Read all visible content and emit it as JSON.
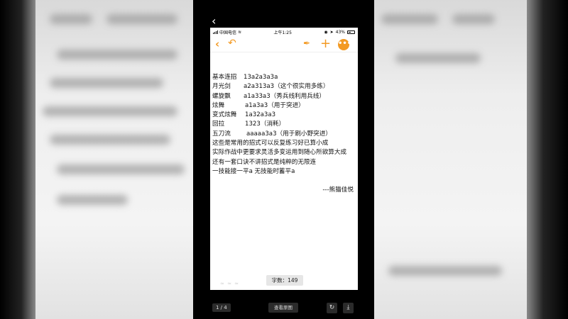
{
  "status_bar": {
    "carrier": "中国电信",
    "time": "上午1:25",
    "battery": "43%"
  },
  "toolbar": {
    "back_icon": "chevron-left-icon",
    "undo_icon": "undo-icon",
    "pen_icon": "pen-icon",
    "add_icon": "plus-icon",
    "more_icon": "more-icon",
    "accent_color": "#f39a23"
  },
  "note": {
    "combos": [
      {
        "name": "基本连招",
        "sequence": "13a2a3a3a"
      },
      {
        "name": "月光剑",
        "sequence": "a2a313a3（这个很实用多练）"
      },
      {
        "name": "螺旋飘",
        "sequence": "a1a33a3（秀兵线利用兵线）"
      },
      {
        "name": "炫舞",
        "sequence": "a1a3a3（用于突进）"
      },
      {
        "name": "变式炫舞",
        "sequence": "1a32a3a3"
      },
      {
        "name": "回拉",
        "sequence": "1323（消耗）"
      },
      {
        "name": "五刀流",
        "sequence": "aaaaa3a3（用于刷小野突进）"
      }
    ],
    "lines": [
      "这些是常用的招式可以反复练习好已算小成",
      "实际作战中更要求灵活多变运用到随心所欲算大成",
      "还有一套口诀不讲招式是纯粹的无限连",
      "一技能接一平a   无技能时蓄平a"
    ],
    "signature": "---熊猫佳悦"
  },
  "word_count": "字数：149",
  "viewer": {
    "back_icon": "chevron-left-icon",
    "page_indicator": "1 / 4",
    "view_original_label": "查看原图",
    "rotate_icon": "rotate-icon",
    "download_icon": "download-icon"
  }
}
